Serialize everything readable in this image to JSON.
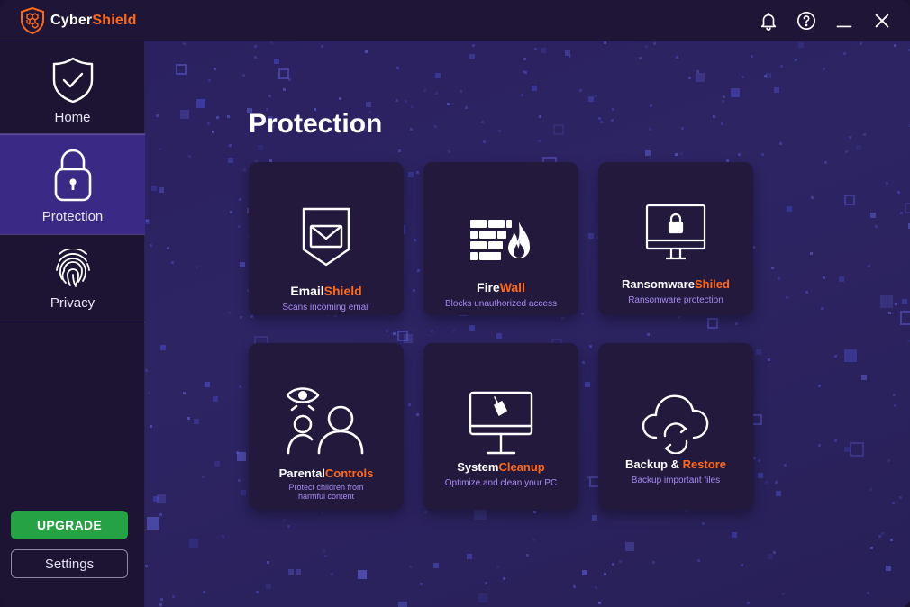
{
  "app": {
    "brand_part1": "Cyber",
    "brand_part2": "Shield"
  },
  "titlebar": {
    "icons": [
      "bell-icon",
      "help-icon",
      "minimize-icon",
      "close-icon"
    ]
  },
  "sidebar": {
    "items": [
      {
        "label": "Home",
        "icon": "shield-check-icon"
      },
      {
        "label": "Protection",
        "icon": "lock-icon",
        "active": true
      },
      {
        "label": "Privacy",
        "icon": "fingerprint-icon"
      }
    ],
    "upgrade_label": "UPGRADE",
    "settings_label": "Settings"
  },
  "main": {
    "title": "Protection",
    "cards": [
      {
        "title_a": "Email",
        "title_b": "Shield",
        "desc": "Scans incoming email",
        "icon": "email-shield-icon"
      },
      {
        "title_a": "Fire",
        "title_b": "Wall",
        "desc": "Blocks unauthorized access",
        "icon": "firewall-icon"
      },
      {
        "title_a": "Ransomware",
        "title_b": "Shiled",
        "desc": "Ransomware protection",
        "icon": "monitor-lock-icon"
      },
      {
        "title_a": "Parental",
        "title_b": "Controls",
        "desc": "Protect children from harmful content",
        "icon": "parental-eye-icon"
      },
      {
        "title_a": "System",
        "title_b": "Cleanup",
        "desc": "Optimize and clean your PC",
        "icon": "monitor-broom-icon"
      },
      {
        "title_a": "Backup & ",
        "title_b": "Restore",
        "desc": "Backup important files",
        "icon": "cloud-sync-icon"
      }
    ]
  },
  "colors": {
    "accent": "#ff6a1a",
    "upgrade": "#25a244",
    "active_nav": "#3a2a86",
    "desc_text": "#a98cf0"
  }
}
